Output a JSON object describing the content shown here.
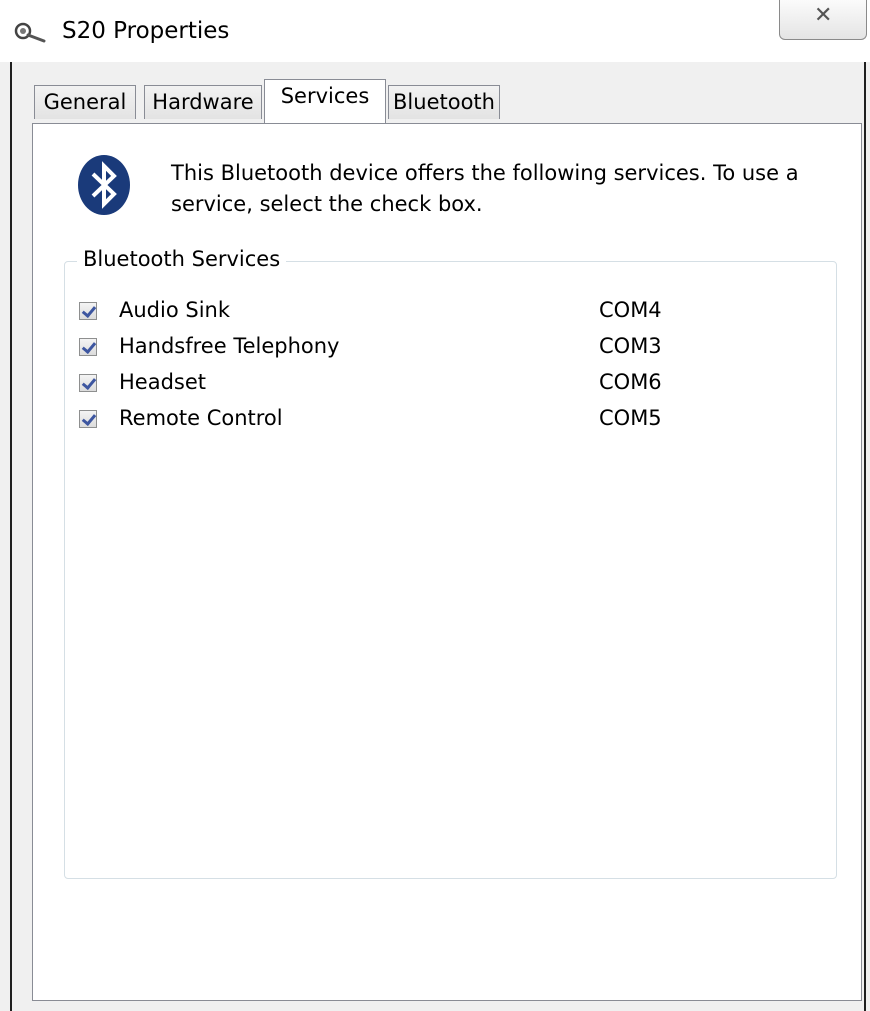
{
  "window": {
    "title": "S20 Properties",
    "close_glyph": "✕"
  },
  "tabs": [
    {
      "label": "General",
      "active": false
    },
    {
      "label": "Hardware",
      "active": false
    },
    {
      "label": "Services",
      "active": true
    },
    {
      "label": "Bluetooth",
      "active": false
    }
  ],
  "services_tab": {
    "icon": "bluetooth-icon",
    "intro_text": "This Bluetooth device offers the following services. To use a service, select the check box.",
    "group_label": "Bluetooth Services",
    "services": [
      {
        "name": "Audio Sink",
        "port": "COM4",
        "checked": true
      },
      {
        "name": "Handsfree Telephony",
        "port": "COM3",
        "checked": true
      },
      {
        "name": "Headset",
        "port": "COM6",
        "checked": true
      },
      {
        "name": "Remote Control",
        "port": "COM5",
        "checked": true
      }
    ]
  },
  "colors": {
    "bluetooth_blue": "#1a3a7a",
    "check_mark": "#3d56a0"
  }
}
